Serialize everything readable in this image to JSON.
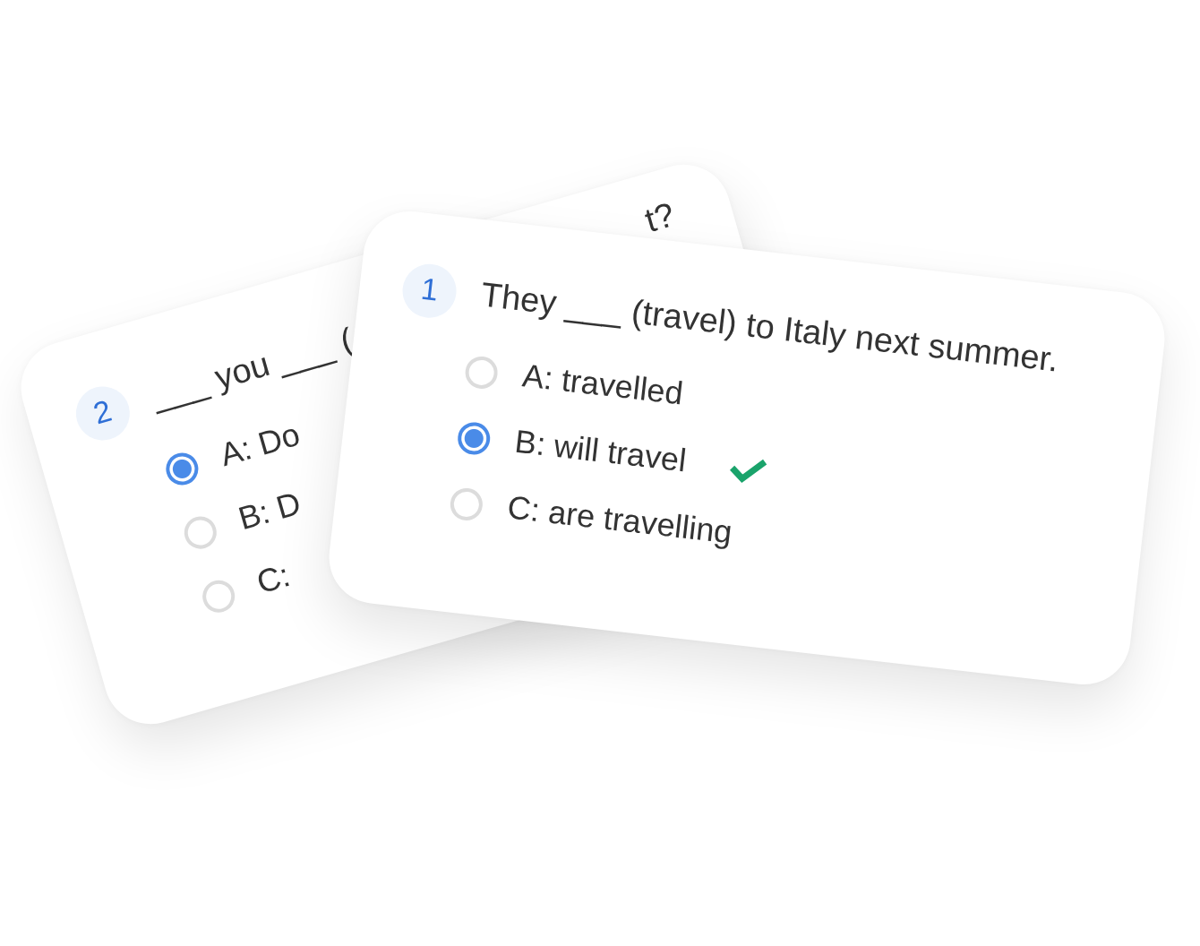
{
  "cards": [
    {
      "number": "2",
      "question": "___ you ___ (",
      "question_end": "t?",
      "options": [
        {
          "label": "A: Do",
          "selected": true,
          "correct": false
        },
        {
          "label": "B: D",
          "selected": false,
          "correct": false
        },
        {
          "label": "C:",
          "selected": false,
          "correct": false
        }
      ]
    },
    {
      "number": "1",
      "question": "They ___ (travel) to Italy next summer.",
      "options": [
        {
          "label": "A: travelled",
          "selected": false,
          "correct": false
        },
        {
          "label": "B: will travel",
          "selected": true,
          "correct": true
        },
        {
          "label": "C: are travelling",
          "selected": false,
          "correct": false
        }
      ]
    }
  ]
}
